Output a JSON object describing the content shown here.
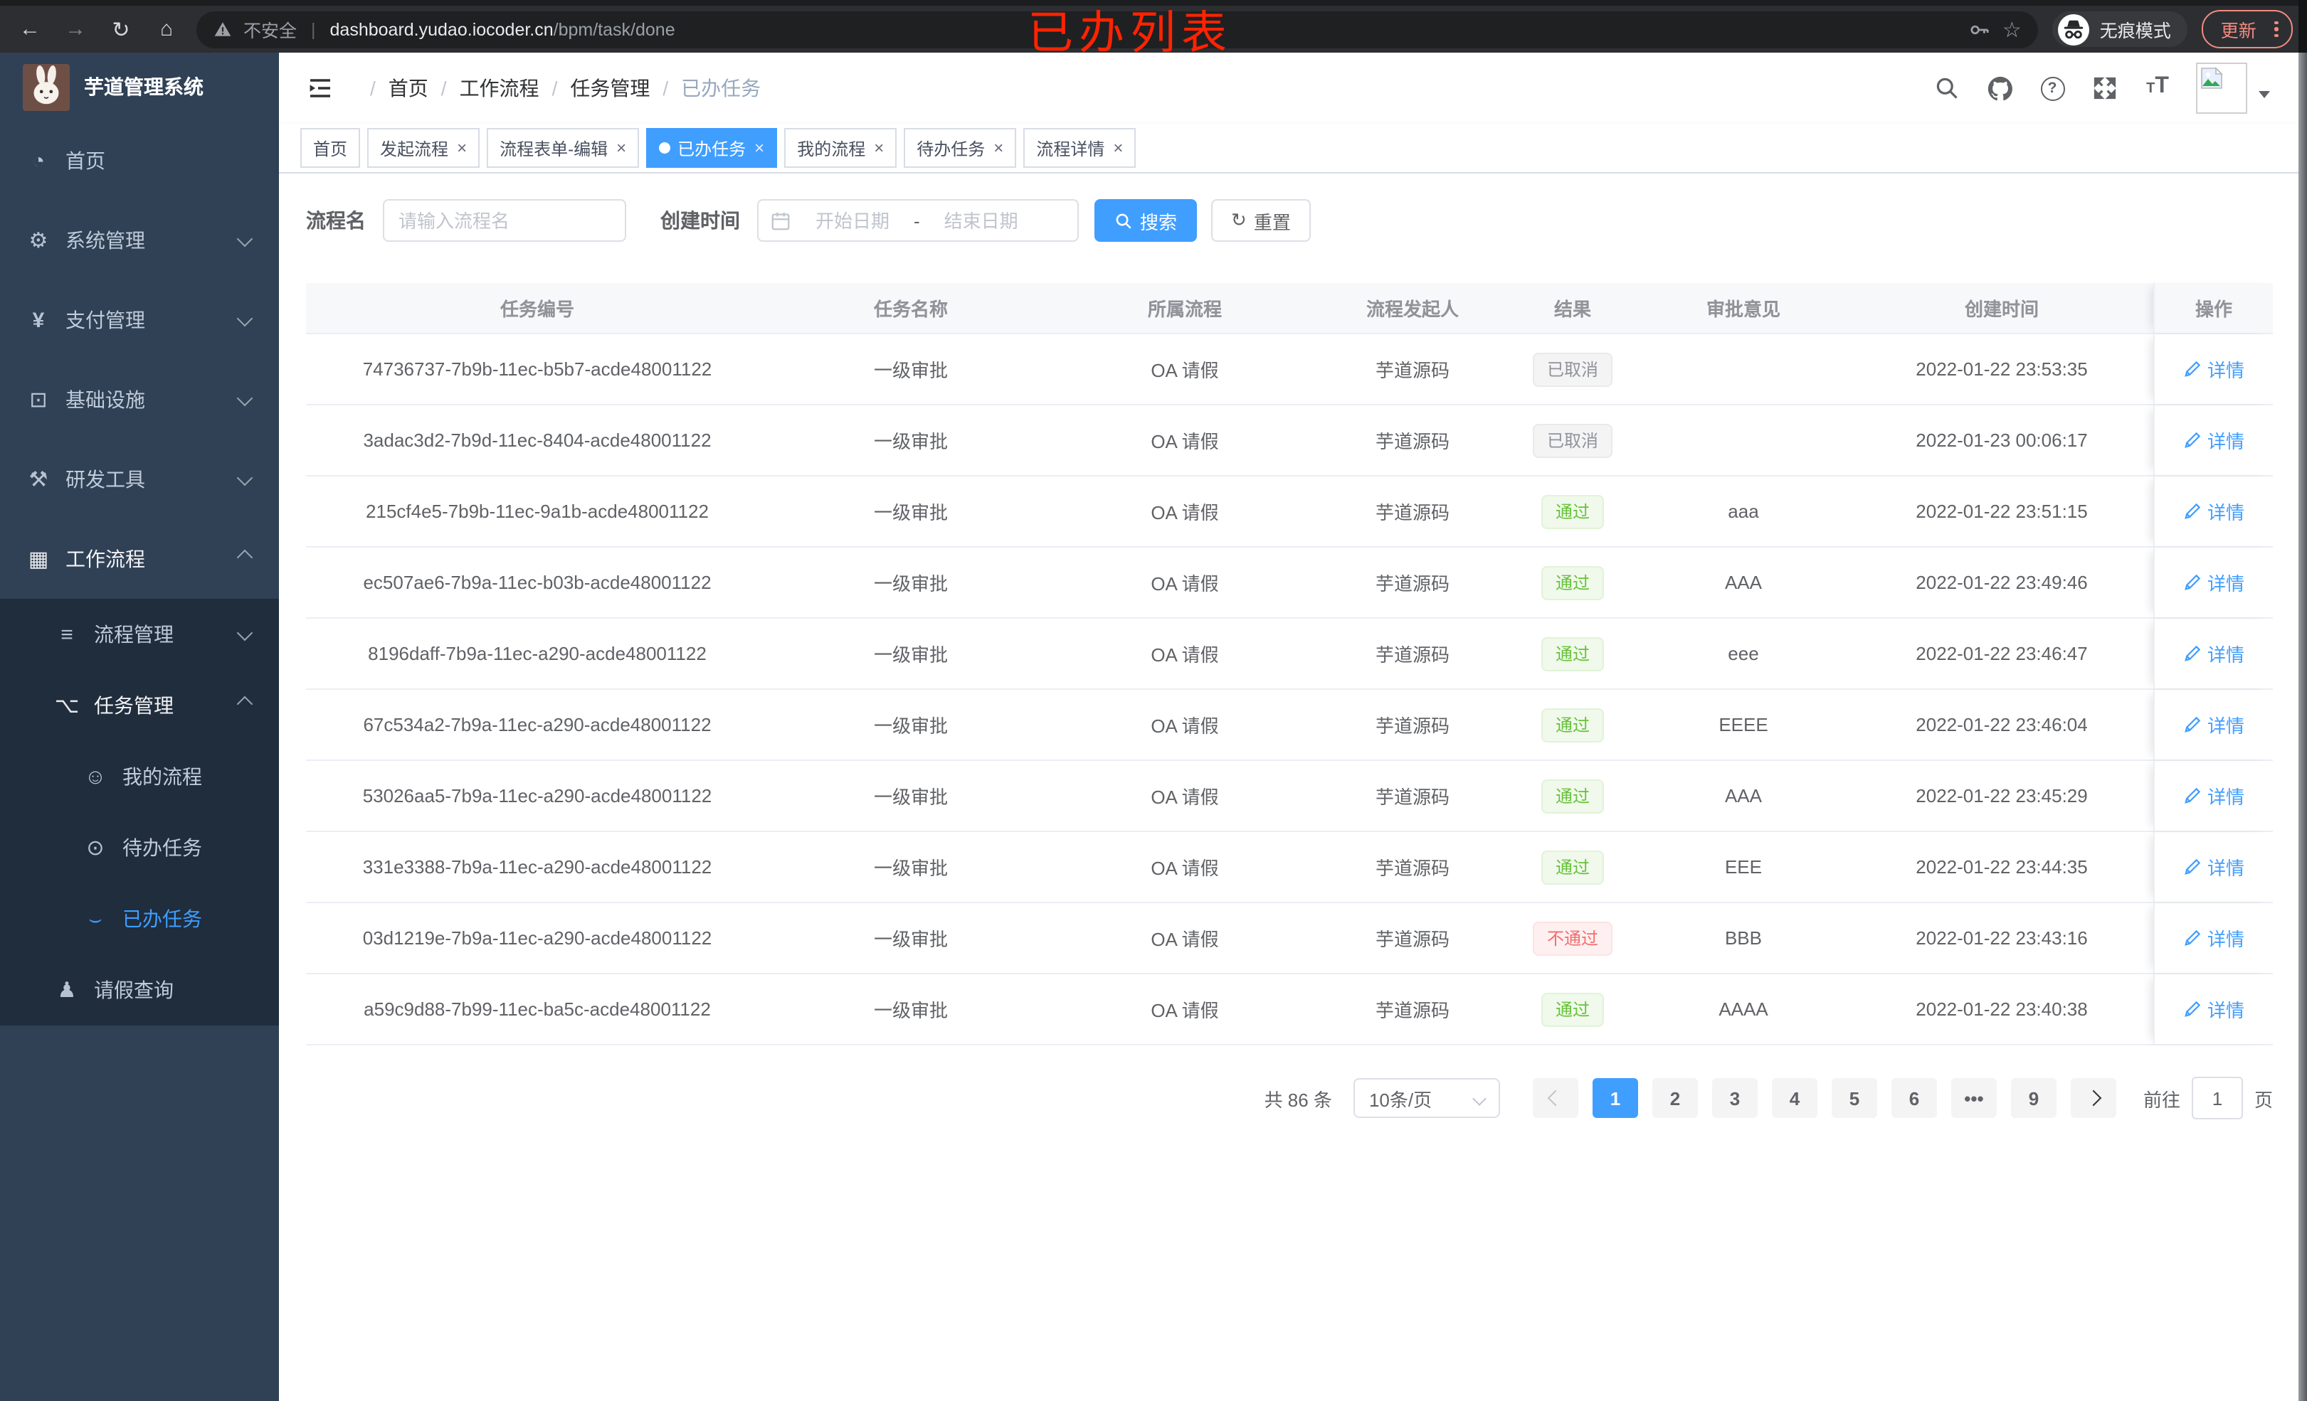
{
  "annotation": {
    "text": "已办列表",
    "color": "#ff2301"
  },
  "browser": {
    "security": "不安全",
    "host": "dashboard.yudao.iocoder.cn",
    "path": "/bpm/task/done",
    "separator": "|",
    "incognito": "无痕模式",
    "update": "更新"
  },
  "sidebar": {
    "title": "芋道管理系统",
    "menu": [
      {
        "label": "首页",
        "icon": "dashboard-icon",
        "level": "1"
      },
      {
        "label": "系统管理",
        "icon": "gear-icon",
        "level": "1",
        "chevron": "down"
      },
      {
        "label": "支付管理",
        "icon": "yen-icon",
        "level": "1",
        "chevron": "down"
      },
      {
        "label": "基础设施",
        "icon": "monitor-icon",
        "level": "1",
        "chevron": "down"
      },
      {
        "label": "研发工具",
        "icon": "toolbox-icon",
        "level": "1",
        "chevron": "down"
      },
      {
        "label": "工作流程",
        "icon": "briefcase-icon",
        "level": "1",
        "chevron": "up",
        "bright": "true"
      },
      {
        "label": "流程管理",
        "icon": "list-icon",
        "level": "2",
        "chevron": "down",
        "sub": "true"
      },
      {
        "label": "任务管理",
        "icon": "tree-icon",
        "level": "2",
        "chevron": "up",
        "sub": "true",
        "bright": "true"
      },
      {
        "label": "我的流程",
        "icon": "robot-icon",
        "level": "3",
        "sub": "true"
      },
      {
        "label": "待办任务",
        "icon": "eye-icon",
        "level": "3",
        "sub": "true"
      },
      {
        "label": "已办任务",
        "icon": "eye-closed-icon",
        "level": "3",
        "sub": "true",
        "active": "true"
      },
      {
        "label": "请假查询",
        "icon": "user-icon",
        "level": "2",
        "sub": "true"
      }
    ]
  },
  "header": {
    "breadcrumb_separator": "/",
    "breadcrumb": [
      {
        "label": "首页"
      },
      {
        "label": "工作流程"
      },
      {
        "label": "任务管理"
      },
      {
        "label": "已办任务",
        "muted": "true"
      }
    ]
  },
  "tabs": [
    {
      "label": "首页"
    },
    {
      "label": "发起流程",
      "closable": "true"
    },
    {
      "label": "流程表单-编辑",
      "closable": "true"
    },
    {
      "label": "已办任务",
      "closable": "true",
      "active": "true"
    },
    {
      "label": "我的流程",
      "closable": "true"
    },
    {
      "label": "待办任务",
      "closable": "true"
    },
    {
      "label": "流程详情",
      "closable": "true"
    }
  ],
  "filters": {
    "name_label": "流程名",
    "name_placeholder": "请输入流程名",
    "time_label": "创建时间",
    "start_placeholder": "开始日期",
    "range_separator": "-",
    "end_placeholder": "结束日期",
    "search_label": "搜索",
    "reset_label": "重置"
  },
  "table": {
    "headers": [
      "任务编号",
      "任务名称",
      "所属流程",
      "流程发起人",
      "结果",
      "审批意见",
      "创建时间",
      "操作"
    ],
    "action_label": "详情",
    "rows": [
      {
        "id": "74736737-7b9b-11ec-b5b7-acde48001122",
        "name": "一级审批",
        "process": "OA 请假",
        "starter": "芋道源码",
        "result": "已取消",
        "result_type": "info",
        "opinion": "",
        "created": "2022-01-22 23:53:35"
      },
      {
        "id": "3adac3d2-7b9d-11ec-8404-acde48001122",
        "name": "一级审批",
        "process": "OA 请假",
        "starter": "芋道源码",
        "result": "已取消",
        "result_type": "info",
        "opinion": "",
        "created": "2022-01-23 00:06:17"
      },
      {
        "id": "215cf4e5-7b9b-11ec-9a1b-acde48001122",
        "name": "一级审批",
        "process": "OA 请假",
        "starter": "芋道源码",
        "result": "通过",
        "result_type": "success",
        "opinion": "aaa",
        "created": "2022-01-22 23:51:15"
      },
      {
        "id": "ec507ae6-7b9a-11ec-b03b-acde48001122",
        "name": "一级审批",
        "process": "OA 请假",
        "starter": "芋道源码",
        "result": "通过",
        "result_type": "success",
        "opinion": "AAA",
        "created": "2022-01-22 23:49:46"
      },
      {
        "id": "8196daff-7b9a-11ec-a290-acde48001122",
        "name": "一级审批",
        "process": "OA 请假",
        "starter": "芋道源码",
        "result": "通过",
        "result_type": "success",
        "opinion": "eee",
        "created": "2022-01-22 23:46:47"
      },
      {
        "id": "67c534a2-7b9a-11ec-a290-acde48001122",
        "name": "一级审批",
        "process": "OA 请假",
        "starter": "芋道源码",
        "result": "通过",
        "result_type": "success",
        "opinion": "EEEE",
        "created": "2022-01-22 23:46:04"
      },
      {
        "id": "53026aa5-7b9a-11ec-a290-acde48001122",
        "name": "一级审批",
        "process": "OA 请假",
        "starter": "芋道源码",
        "result": "通过",
        "result_type": "success",
        "opinion": "AAA",
        "created": "2022-01-22 23:45:29"
      },
      {
        "id": "331e3388-7b9a-11ec-a290-acde48001122",
        "name": "一级审批",
        "process": "OA 请假",
        "starter": "芋道源码",
        "result": "通过",
        "result_type": "success",
        "opinion": "EEE",
        "created": "2022-01-22 23:44:35"
      },
      {
        "id": "03d1219e-7b9a-11ec-a290-acde48001122",
        "name": "一级审批",
        "process": "OA 请假",
        "starter": "芋道源码",
        "result": "不通过",
        "result_type": "danger",
        "opinion": "BBB",
        "created": "2022-01-22 23:43:16"
      },
      {
        "id": "a59c9d88-7b99-11ec-ba5c-acde48001122",
        "name": "一级审批",
        "process": "OA 请假",
        "starter": "芋道源码",
        "result": "通过",
        "result_type": "success",
        "opinion": "AAAA",
        "created": "2022-01-22 23:40:38"
      }
    ]
  },
  "pagination": {
    "total": "共 86 条",
    "page_size": "10条/页",
    "pages": [
      {
        "t": "1",
        "active": "true"
      },
      {
        "t": "2"
      },
      {
        "t": "3"
      },
      {
        "t": "4"
      },
      {
        "t": "5"
      },
      {
        "t": "6"
      },
      {
        "t": "•••"
      },
      {
        "t": "9"
      }
    ],
    "jump_prefix": "前往",
    "jump_value": "1",
    "jump_suffix": "页"
  },
  "colors": {
    "accent": "#409eff",
    "sidebar_bg": "#304156",
    "submenu_bg": "#1f2d3d",
    "success": "#67c23a",
    "danger": "#f56c6c",
    "info": "#909399",
    "annotation_red": "#ff2301"
  }
}
